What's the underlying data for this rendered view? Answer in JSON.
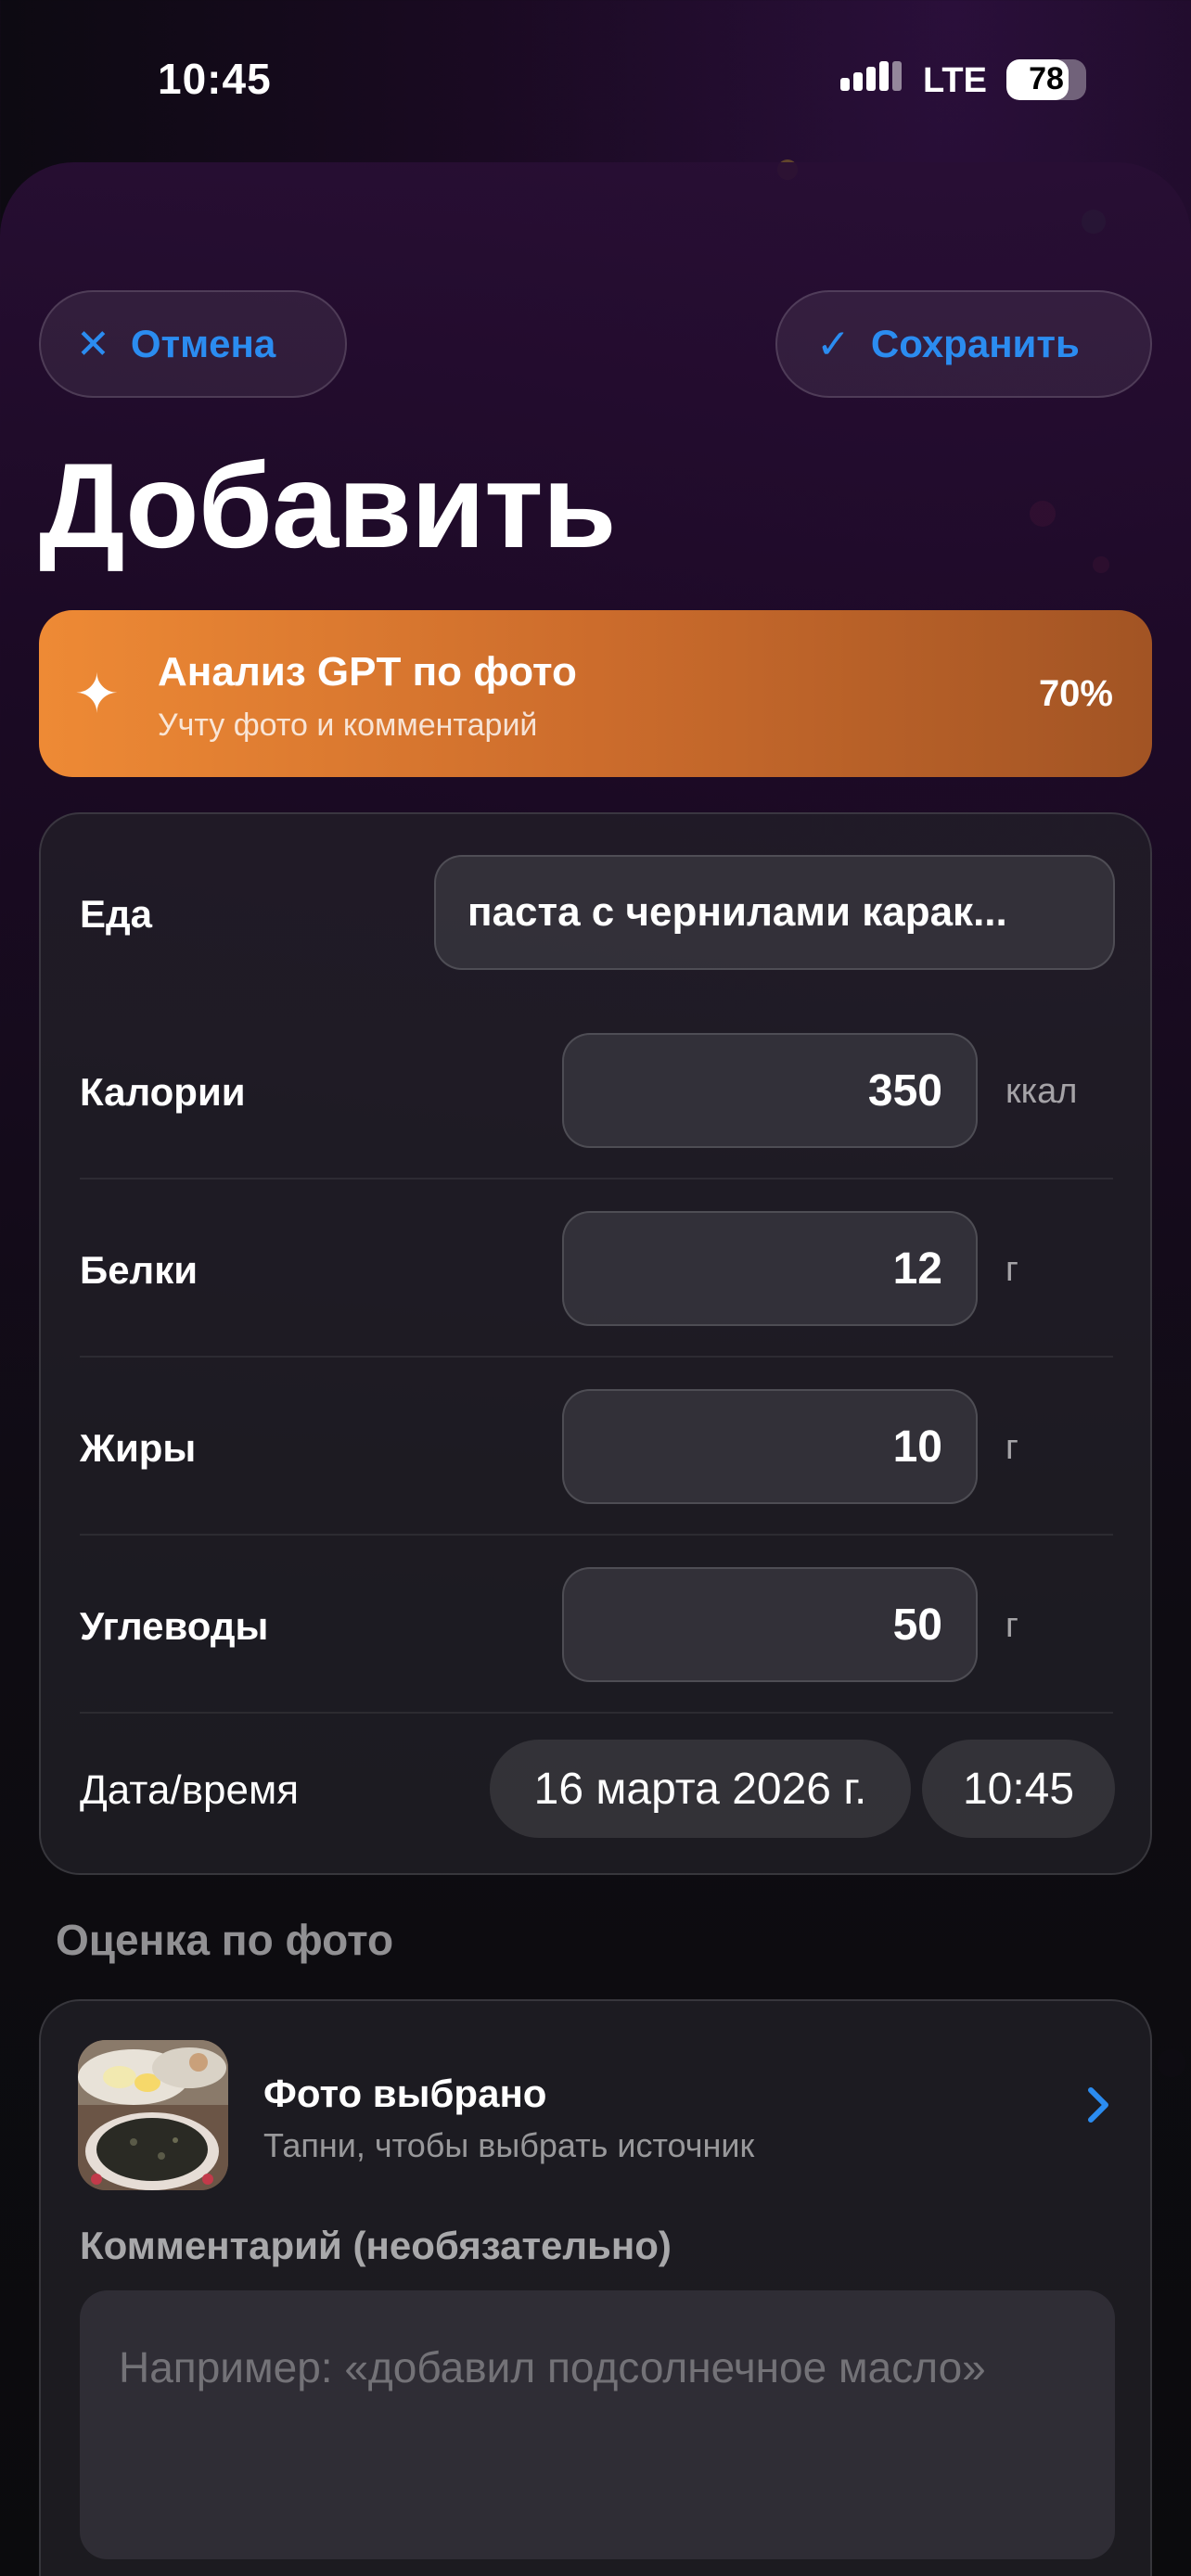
{
  "status_bar": {
    "time": "10:45",
    "network": "LTE",
    "battery": "78",
    "battery_level": 0.78
  },
  "header": {
    "cancel_label": "Отмена",
    "save_label": "Сохранить",
    "title": "Добавить"
  },
  "gpt_banner": {
    "title": "Анализ GPT по фото",
    "subtitle": "Учту фото и комментарий",
    "progress_text": "70%",
    "progress": 0.7
  },
  "form": {
    "food": {
      "label": "Еда",
      "value": "паста с чернилами карак..."
    },
    "calories": {
      "label": "Калории",
      "value": "350",
      "unit": "ккал"
    },
    "protein": {
      "label": "Белки",
      "value": "12",
      "unit": "г"
    },
    "fat": {
      "label": "Жиры",
      "value": "10",
      "unit": "г"
    },
    "carbs": {
      "label": "Углеводы",
      "value": "50",
      "unit": "г"
    },
    "datetime": {
      "label": "Дата/время",
      "date": "16 марта 2026 г.",
      "time": "10:45"
    }
  },
  "photo_section": {
    "title": "Оценка по фото",
    "photo_title": "Фото выбрано",
    "photo_subtitle": "Тапни, чтобы выбрать источник",
    "comment_label": "Комментарий (необязательно)",
    "comment_placeholder": "Например: «добавил подсолнечное масло»",
    "comment_value": ""
  },
  "colors": {
    "accent": "#2b8cf0",
    "banner_start": "#ee8a35",
    "banner_end": "#a25424"
  }
}
